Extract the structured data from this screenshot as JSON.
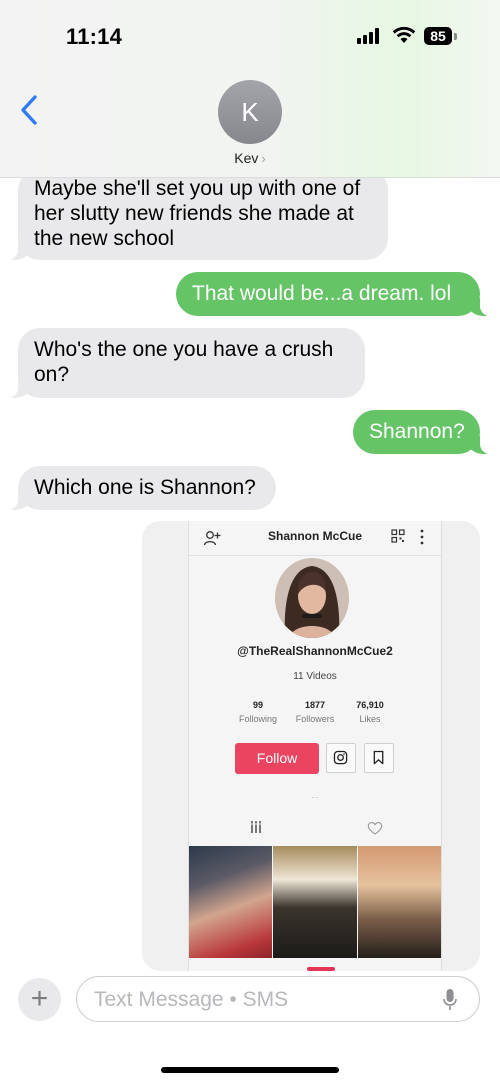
{
  "status_bar": {
    "time": "11:14",
    "battery": "85"
  },
  "header": {
    "avatar_initial": "K",
    "contact_name": "Kev",
    "contact_chevron": "›"
  },
  "messages": [
    {
      "side": "incoming",
      "text": "Maybe she'll set you up with one of her slutty new friends she made at the new school"
    },
    {
      "side": "outgoing",
      "text": "That would be...a dream. lol"
    },
    {
      "side": "incoming",
      "text": "Who's the one you have a crush on?"
    },
    {
      "side": "outgoing",
      "text": "Shannon?"
    },
    {
      "side": "incoming",
      "text": "Which one is Shannon?"
    }
  ],
  "screenshot": {
    "profile_name": "Shannon McCue",
    "handle": "@TheRealShannonMcCue2",
    "videos": "11 Videos",
    "stats": [
      {
        "value": "99",
        "label": "Following"
      },
      {
        "value": "1877",
        "label": "Followers"
      },
      {
        "value": "76,910",
        "label": "Likes"
      }
    ],
    "follow_label": "Follow",
    "dots": "...",
    "icons": [
      "add-user-icon",
      "qr-code-icon",
      "more-vertical-icon",
      "instagram-icon",
      "bookmark-icon",
      "grid-icon",
      "heart-icon"
    ]
  },
  "input": {
    "plus": "+",
    "placeholder": "Text Message • SMS"
  },
  "colors": {
    "outgoing": "#65c466",
    "incoming": "#e9e9eb",
    "accent": "#2f7cf6",
    "follow": "#ea4461"
  }
}
